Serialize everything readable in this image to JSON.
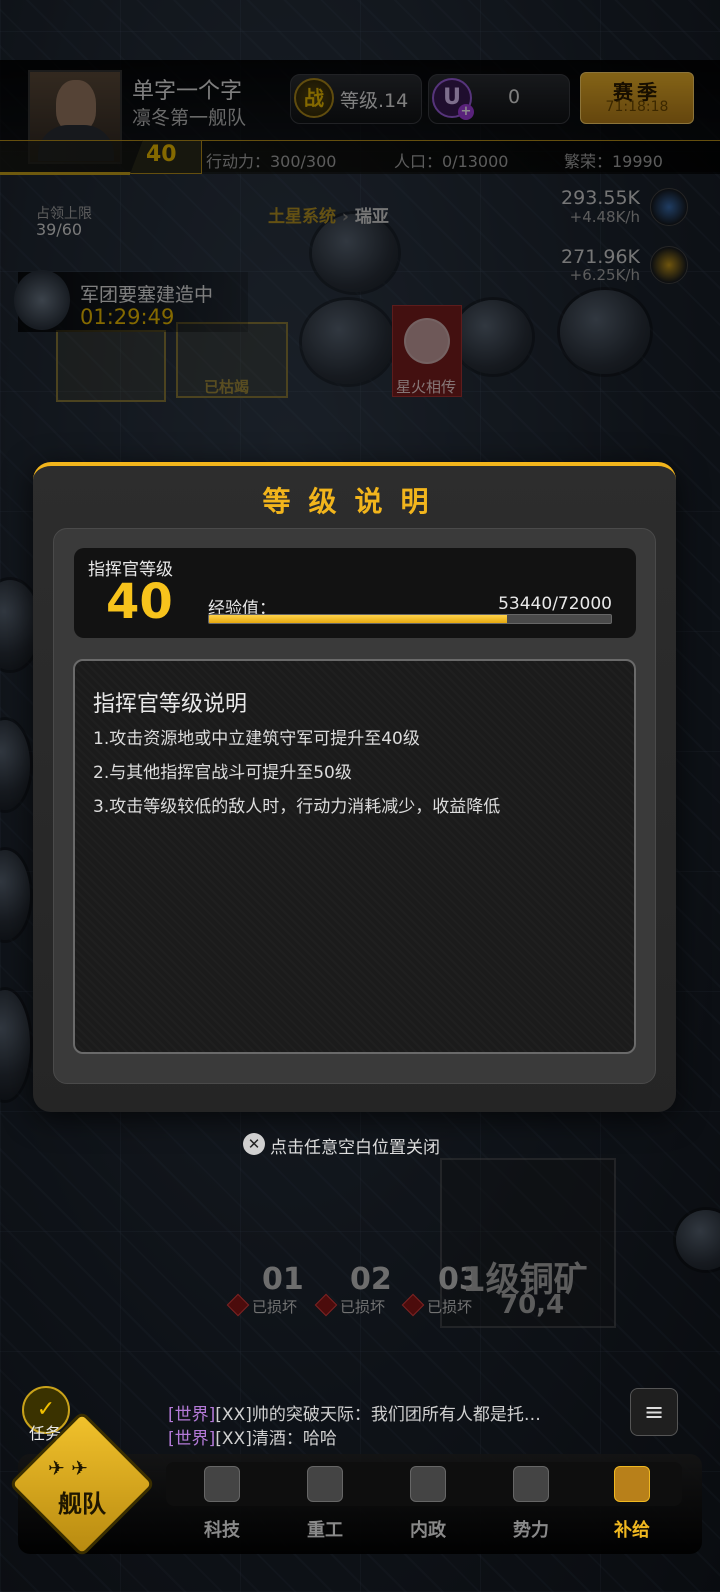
{
  "header": {
    "player_name": "单字一个字",
    "fleet_name": "凛冬第一舰队",
    "rank_icon": "战",
    "rank_label": "等级.14",
    "u_icon": "U",
    "u_plus": "+",
    "u_value": "0",
    "season_label": "赛季",
    "season_timer": "71:18:18",
    "level": "40",
    "action_points": "行动力：300/300",
    "population": "人口：0/13000",
    "prosperity": "繁荣：19990"
  },
  "map": {
    "occupy_label": "占领上限",
    "occupy_value": "39/60",
    "region_system": "土星系统",
    "region_sep": "›",
    "region_location": "瑞亚",
    "resource_1_value": "293.55K",
    "resource_1_rate": "+4.48K/h",
    "resource_2_value": "271.96K",
    "resource_2_rate": "+6.25K/h",
    "fortress_title": "军团要塞建造中",
    "fortress_timer": "01:29:49",
    "plot_label": "已枯竭",
    "banner_text": "星火相传"
  },
  "modal": {
    "title": "等级说明",
    "commander_level_label": "指挥官等级",
    "commander_level": "40",
    "exp_label": "经验值：",
    "exp_value": "53440/72000",
    "exp_current": 53440,
    "exp_max": 72000,
    "desc_title": "指挥官等级说明",
    "desc_items": [
      "1.攻击资源地或中立建筑守军可提升至40级",
      "2.与其他指挥官战斗可提升至50级",
      "3.攻击等级较低的敌人时，行动力消耗减少，收益降低"
    ],
    "close_hint": "点击任意空白位置关闭"
  },
  "bottom_map": {
    "slots": [
      {
        "num": "01",
        "status": "已损坏"
      },
      {
        "num": "02",
        "status": "已损坏"
      },
      {
        "num": "03",
        "status": "已损坏"
      }
    ],
    "mine_name": "1级铜矿",
    "mine_coord": "70,4"
  },
  "chat": {
    "line1_channel": "[世界]",
    "line1_text": "[XX]帅的突破天际：我们团所有人都是托…",
    "line2_channel": "[世界]",
    "line2_text": "[XX]清酒：哈哈",
    "list_icon": "≡",
    "task_label": "任务",
    "task_icon": "✓"
  },
  "nav": {
    "fleet_label": "舰队",
    "items": [
      {
        "label": "科技",
        "icon": "tech-icon"
      },
      {
        "label": "重工",
        "icon": "industry-icon"
      },
      {
        "label": "内政",
        "icon": "internal-affairs-icon"
      },
      {
        "label": "势力",
        "icon": "faction-icon"
      },
      {
        "label": "补给",
        "icon": "supply-icon"
      }
    ]
  },
  "colors": {
    "accent": "#f2b51c",
    "exp_fill": "#f0b820",
    "nav_active": "#f0b820",
    "nav_inactive": "#8a8a8a",
    "chat_channel": "#b47ad8"
  }
}
